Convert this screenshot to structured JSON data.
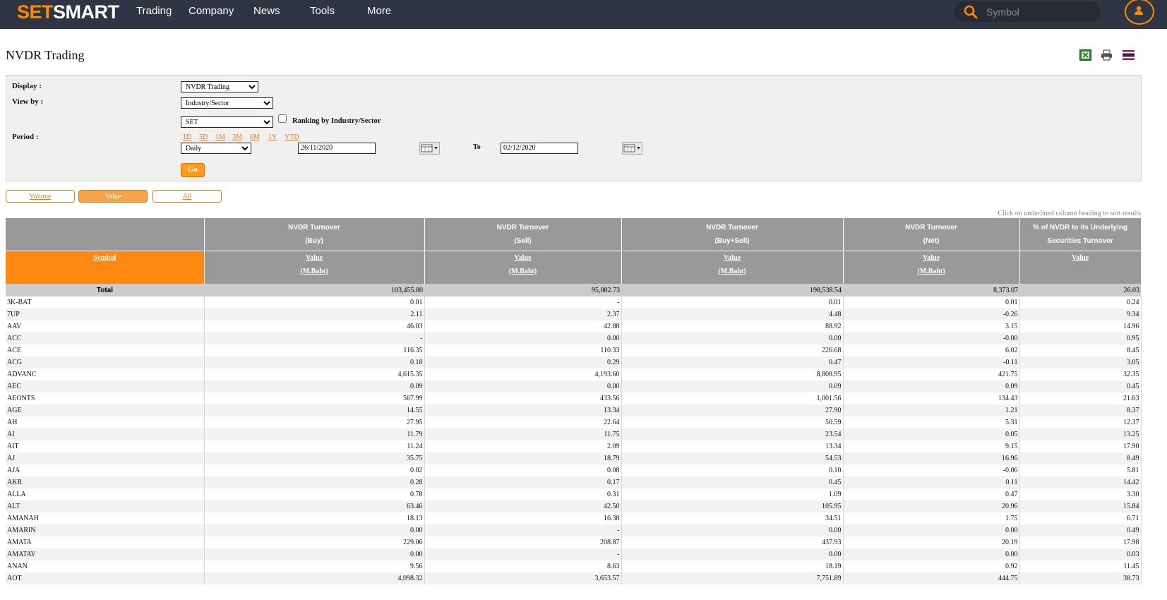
{
  "nav": {
    "logo_part1": "SET",
    "logo_part2": "SMART",
    "items": [
      "Trading",
      "Company",
      "News",
      "Tools",
      "More"
    ],
    "search_placeholder": "Symbol"
  },
  "page": {
    "title": "NVDR Trading"
  },
  "filters": {
    "display_label": "Display :",
    "display_value": "NVDR Trading",
    "viewby_label": "View by :",
    "viewby_value": "Industry/Sector",
    "market_value": "SET",
    "ranking_label": "Ranking by Industry/Sector",
    "period_label": "Period :",
    "period_links": [
      "1D",
      "5D",
      "1M",
      "3M",
      "6M",
      "1Y",
      "YTD"
    ],
    "frequency_value": "Daily",
    "from_date": "26/11/2020",
    "to_label": "To",
    "to_date": "02/12/2020",
    "go_label": "Go"
  },
  "toggles": {
    "volume": "Volume",
    "value": "Value",
    "all": "All"
  },
  "sort_note": "Click on underlined column heading to sort results",
  "table": {
    "groups": [
      {
        "l1": "NVDR Turnover",
        "l2": "(Buy)"
      },
      {
        "l1": "NVDR Turnover",
        "l2": "(Sell)"
      },
      {
        "l1": "NVDR Turnover",
        "l2": "(Buy+Sell)"
      },
      {
        "l1": "NVDR Turnover",
        "l2": "(Net)"
      },
      {
        "l1": "% of NVDR to its Underlying",
        "l2": "Securities Turnover"
      }
    ],
    "symbol_header": "Symbol",
    "value_header": "Value",
    "unit_header": "(M.Baht)",
    "total": {
      "label": "Total",
      "buy": "103,455.80",
      "sell": "95,082.73",
      "buysell": "198,538.54",
      "net": "8,373.07",
      "pct": "26.03"
    },
    "rows": [
      [
        "3K-BAT",
        "0.01",
        "-",
        "0.01",
        "0.01",
        "0.24"
      ],
      [
        "7UP",
        "2.11",
        "2.37",
        "4.48",
        "-0.26",
        "9.34"
      ],
      [
        "AAV",
        "46.03",
        "42.88",
        "88.92",
        "3.15",
        "14.96"
      ],
      [
        "ACC",
        "-",
        "0.00",
        "0.00",
        "-0.00",
        "0.95"
      ],
      [
        "ACE",
        "116.35",
        "110.33",
        "226.68",
        "6.02",
        "8.45"
      ],
      [
        "ACG",
        "0.18",
        "0.29",
        "0.47",
        "-0.11",
        "3.05"
      ],
      [
        "ADVANC",
        "4,615.35",
        "4,193.60",
        "8,808.95",
        "421.75",
        "32.35"
      ],
      [
        "AEC",
        "0.09",
        "0.00",
        "0.09",
        "0.09",
        "0.45"
      ],
      [
        "AEONTS",
        "567.99",
        "433.56",
        "1,001.56",
        "134.43",
        "21.63"
      ],
      [
        "AGE",
        "14.55",
        "13.34",
        "27.90",
        "1.21",
        "8.37"
      ],
      [
        "AH",
        "27.95",
        "22.64",
        "50.59",
        "5.31",
        "12.37"
      ],
      [
        "AI",
        "11.79",
        "11.75",
        "23.54",
        "0.05",
        "13.25"
      ],
      [
        "AIT",
        "11.24",
        "2.09",
        "13.34",
        "9.15",
        "17.90"
      ],
      [
        "AJ",
        "35.75",
        "18.79",
        "54.53",
        "16.96",
        "8.49"
      ],
      [
        "AJA",
        "0.02",
        "0.08",
        "0.10",
        "-0.06",
        "5.81"
      ],
      [
        "AKR",
        "0.28",
        "0.17",
        "0.45",
        "0.11",
        "14.42"
      ],
      [
        "ALLA",
        "0.78",
        "0.31",
        "1.09",
        "0.47",
        "3.30"
      ],
      [
        "ALT",
        "63.46",
        "42.50",
        "105.95",
        "20.96",
        "15.84"
      ],
      [
        "AMANAH",
        "18.13",
        "16.38",
        "34.51",
        "1.75",
        "6.71"
      ],
      [
        "AMARIN",
        "0.00",
        "-",
        "0.00",
        "0.00",
        "0.49"
      ],
      [
        "AMATA",
        "229.06",
        "208.87",
        "437.93",
        "20.19",
        "17.98"
      ],
      [
        "AMATAV",
        "0.00",
        "-",
        "0.00",
        "0.00",
        "0.03"
      ],
      [
        "ANAN",
        "9.56",
        "8.63",
        "18.19",
        "0.92",
        "11.45"
      ],
      [
        "AOT",
        "4,098.32",
        "3,653.57",
        "7,751.89",
        "444.75",
        "38.73"
      ]
    ]
  }
}
